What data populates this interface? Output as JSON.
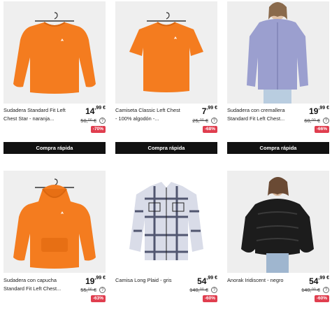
{
  "products": [
    {
      "name": "Sudadera Standard Fit Left Chest Star - naranja...",
      "price_int": "14",
      "price_dec": "99 €",
      "old_price": "50,⁰⁰ €",
      "discount": "-70%",
      "button": "Compra rápida"
    },
    {
      "name": "Camiseta Classic Left Chest - 100% algodón -...",
      "price_int": "7",
      "price_dec": "99 €",
      "old_price": "25,⁰⁰ €",
      "discount": "-68%",
      "button": "Compra rápida"
    },
    {
      "name": "Sudadera con cremallera Standard Fit Left Chest...",
      "price_int": "19",
      "price_dec": "99 €",
      "old_price": "60,⁰⁰ €",
      "discount": "-66%",
      "button": "Compra rápida"
    },
    {
      "name": "Sudadera con capucha Standard Fit Left Chest...",
      "price_int": "19",
      "price_dec": "99 €",
      "old_price": "55,⁰⁰ €",
      "discount": "-63%"
    },
    {
      "name": "Camisa Long Plaid - gris",
      "price_int": "54",
      "price_dec": "99 €",
      "old_price": "140,⁰⁰ €",
      "discount": "-60%"
    },
    {
      "name": "Anorak Iridiscent - negro",
      "price_int": "54",
      "price_dec": "99 €",
      "old_price": "140,⁰⁰ €",
      "discount": "-60%"
    }
  ],
  "info_glyph": "?",
  "colors": {
    "accent_badge": "#e03e4f",
    "button_bg": "#111111",
    "orange": "#f47c1f",
    "lavender": "#9b9fcf",
    "puffer": "#1c1c1c"
  },
  "icons": [
    "hoodie-image",
    "tshirt-image",
    "zip-hoodie-model-image",
    "hooded-sweatshirt-image",
    "plaid-shirt-image",
    "puffer-jacket-model-image",
    "info-icon"
  ]
}
